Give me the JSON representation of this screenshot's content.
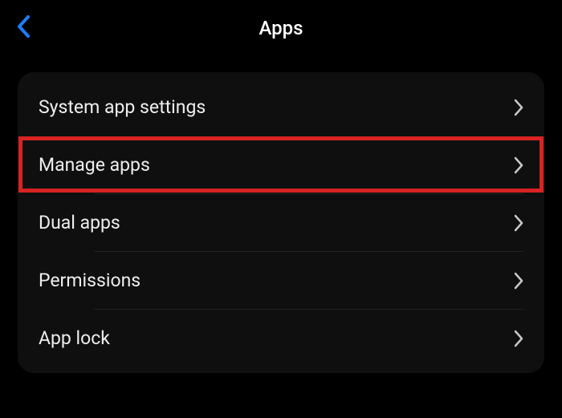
{
  "header": {
    "title": "Apps"
  },
  "items": [
    {
      "label": "System app settings"
    },
    {
      "label": "Manage apps"
    },
    {
      "label": "Dual apps"
    },
    {
      "label": "Permissions"
    },
    {
      "label": "App lock"
    }
  ],
  "colors": {
    "back_arrow": "#1e7dff",
    "chevron": "#c8c8c8",
    "highlight": "#d82323"
  }
}
